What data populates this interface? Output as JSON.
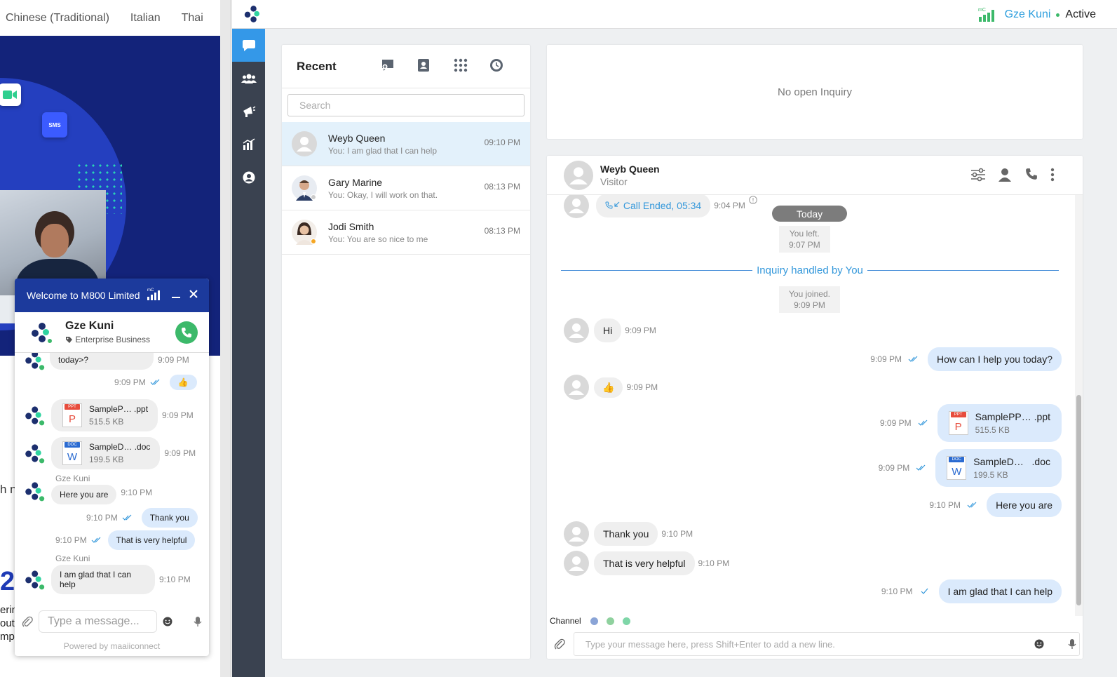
{
  "site": {
    "languages": [
      "Chinese (Traditional)",
      "Italian",
      "Thai"
    ],
    "sms_chip": "SMS",
    "text_fragment": "h n",
    "big_char": "2",
    "frag_lines": [
      "erin",
      "outp",
      "mpe"
    ]
  },
  "widget": {
    "title": "Welcome to M800 Limited",
    "signal_label": "mC",
    "agent_name": "Gze Kuni",
    "agent_tag": "Enterprise Business",
    "messages": {
      "m1_text": "today>?",
      "m1_time": "9:09 PM",
      "m2_time": "9:09 PM",
      "m2_emoji": "👍",
      "f1_name": "SampleP… .ppt",
      "f1_size": "515.5 KB",
      "f1_time": "9:09 PM",
      "f1_tag": "PPT",
      "f1_letter": "P",
      "f2_name": "SampleD… .doc",
      "f2_size": "199.5 KB",
      "f2_time": "9:09 PM",
      "f2_tag": "DOC",
      "f2_letter": "W",
      "sender1": "Gze Kuni",
      "m3_text": "Here you are",
      "m3_time": "9:10 PM",
      "m4_text": "Thank you",
      "m4_time": "9:10 PM",
      "m5_text": "That is very helpful",
      "m5_time": "9:10 PM",
      "sender2": "Gze Kuni",
      "m6_text": "I am glad that I can help",
      "m6_time": "9:10 PM"
    },
    "input_placeholder": "Type a message...",
    "powered_by": "Powered by maaiiconnect"
  },
  "app": {
    "signal_label": "mC",
    "user_name": "Gze Kuni",
    "status": "Active",
    "accent": "#3498e8",
    "rail_items": [
      "chat-icon",
      "team-icon",
      "broadcast-icon",
      "analytics-icon",
      "profile-icon"
    ]
  },
  "recent": {
    "title": "Recent",
    "search_placeholder": "Search",
    "conversations": [
      {
        "name": "Weyb Queen",
        "preview": "You: I am glad that I can help",
        "time": "09:10 PM"
      },
      {
        "name": "Gary Marine",
        "preview": "You: Okay, I will work on that.",
        "time": "08:13 PM"
      },
      {
        "name": "Jodi Smith",
        "preview": "You: You are so nice to me",
        "time": "08:13 PM"
      }
    ]
  },
  "inquiry": {
    "empty_text": "No open Inquiry"
  },
  "conversation": {
    "name": "Weyb Queen",
    "role": "Visitor",
    "call_text": "Call Ended, 05:34",
    "call_time": "9:04 PM",
    "today": "Today",
    "left_note": "You left.",
    "left_time": "9:07 PM",
    "handled": "Inquiry handled by You",
    "joined_note": "You joined.",
    "joined_time": "9:09 PM",
    "messages": {
      "hi": "Hi",
      "hi_time": "9:09 PM",
      "help": "How can I help you today?",
      "help_time": "9:09 PM",
      "thumb": "👍",
      "thumb_time": "9:09 PM",
      "f1_name": "SamplePP… .ppt",
      "f1_size": "515.5 KB",
      "f1_time": "9:09 PM",
      "f1_tag": "PPT",
      "f1_letter": "P",
      "f2_name": "SampleD…   .doc",
      "f2_size": "199.5 KB",
      "f2_time": "9:09 PM",
      "f2_tag": "DOC",
      "f2_letter": "W",
      "here": "Here you are",
      "here_time": "9:10 PM",
      "thanks": "Thank you",
      "thanks_time": "9:10 PM",
      "helpful": "That is very helpful",
      "helpful_time": "9:10 PM",
      "glad": "I am glad that I can help",
      "glad_time": "9:10 PM"
    },
    "channel_label": "Channel",
    "channel_colors": [
      "#8aa4d6",
      "#8fd19e",
      "#7fd6a8"
    ],
    "composer_placeholder": "Type your message here, press Shift+Enter to add a new line."
  }
}
